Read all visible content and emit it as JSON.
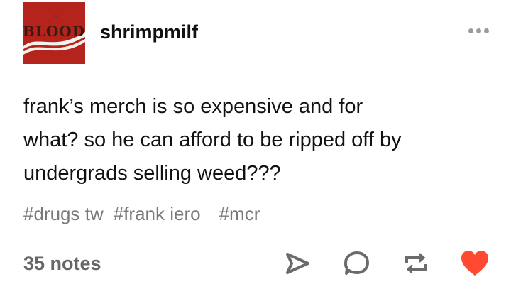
{
  "post": {
    "username": "shrimpmilf",
    "avatar": {
      "icon": "blood-avatar-image",
      "text": "BLOOD",
      "background": "#b4231c"
    },
    "more_icon": "more-dots-icon",
    "body": "frank’s merch is so expensive and for\nwhat? so he can afford to be ripped off by\nundergrads selling weed???",
    "tags": [
      "#drugs tw",
      "#frank iero",
      "#mcr"
    ],
    "notes": "35 notes",
    "actions": {
      "share_icon": "share-icon",
      "reply_icon": "reply-icon",
      "reblog_icon": "reblog-icon",
      "like_icon": "heart-icon",
      "like_color": "#ff4930",
      "icon_color": "#6b6b6b"
    }
  }
}
